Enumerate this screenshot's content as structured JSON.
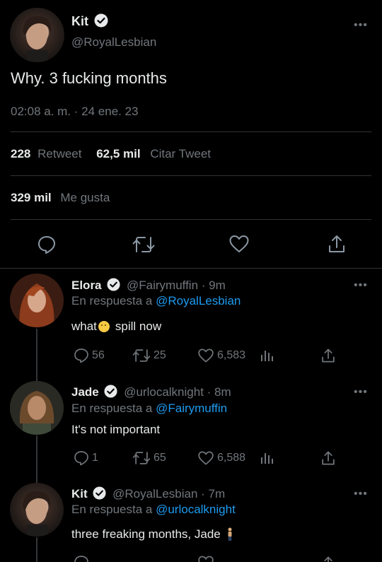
{
  "main_tweet": {
    "author_name": "Kit",
    "handle": "@RoyalLesbian",
    "text": "Why. 3 fucking months",
    "timestamp": "02:08 a. m. · 24 ene. 23",
    "retweets_count": "228",
    "retweets_label": "Retweet",
    "quotes_count": "62,5 mil",
    "quotes_label": "Citar Tweet",
    "likes_count": "329 mil",
    "likes_label": "Me gusta",
    "more": "•••"
  },
  "replies": [
    {
      "author_name": "Elora",
      "handle_time": "@Fairymuffin · 9m",
      "reply_prefix": "En respuesta a",
      "reply_to": "@RoyalLesbian",
      "text": "what",
      "text_suffix": "spill now",
      "replies": "56",
      "retweets": "25",
      "likes": "6,583",
      "more": "•••"
    },
    {
      "author_name": "Jade",
      "handle_time": "@urlocalknight · 8m",
      "reply_prefix": "En respuesta a",
      "reply_to": "@Fairymuffin",
      "text": "It's not important",
      "replies": "1",
      "retweets": "65",
      "likes": "6,588",
      "more": "•••"
    },
    {
      "author_name": "Kit",
      "handle_time": "@RoyalLesbian · 7m",
      "reply_prefix": "En respuesta a",
      "reply_to": "@urlocalknight",
      "text": "three freaking months, Jade",
      "more": "•••"
    }
  ],
  "colors": {
    "background": "#000000",
    "text": "#e7e9ea",
    "muted": "#71767b",
    "link": "#1d9bf0",
    "divider": "#2f3336"
  }
}
